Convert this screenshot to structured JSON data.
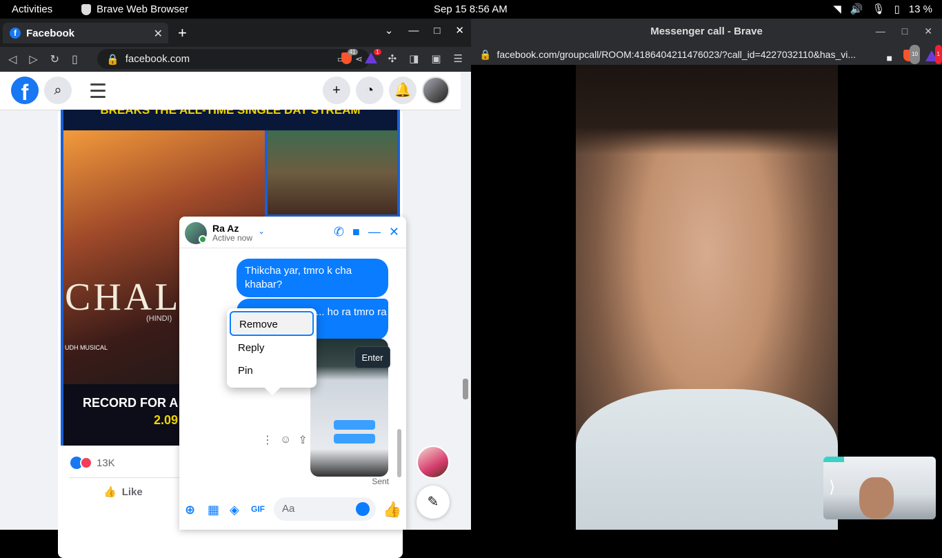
{
  "topbar": {
    "activities": "Activities",
    "app_name": "Brave Web Browser",
    "clock": "Sep 15  8:56 AM",
    "battery": "13 %"
  },
  "left_browser": {
    "tab_title": "Facebook",
    "url": "facebook.com",
    "brave_badge": "41",
    "rewards_badge": "1"
  },
  "post": {
    "banner_text": "BREAKS THE ALL-TIME SINGLE DAY STREAM",
    "movie_title": "CHAL",
    "hindi": "(HINDI)",
    "record_text": "RECORD FOR A",
    "record_number": "2.09",
    "music_label": "UDH MUSICAL",
    "reaction_count": "13K",
    "like_label": "Like"
  },
  "chat": {
    "name": "Ra Az",
    "status": "Active now",
    "message1": "Thikcha yar, tmro k cha khabar?",
    "message2": "... ho ra tmro ra",
    "enter_tip": "Enter",
    "sent_label": "Sent",
    "input_placeholder": "Aa",
    "gif_label": "GIF",
    "menu": {
      "remove": "Remove",
      "reply": "Reply",
      "pin": "Pin"
    }
  },
  "right_window": {
    "title": "Messenger call - Brave",
    "url": "facebook.com/groupcall/ROOM:4186404211476023/?call_id=4227032110&has_vi...",
    "brave_badge": "10",
    "rewards_badge": "1"
  }
}
